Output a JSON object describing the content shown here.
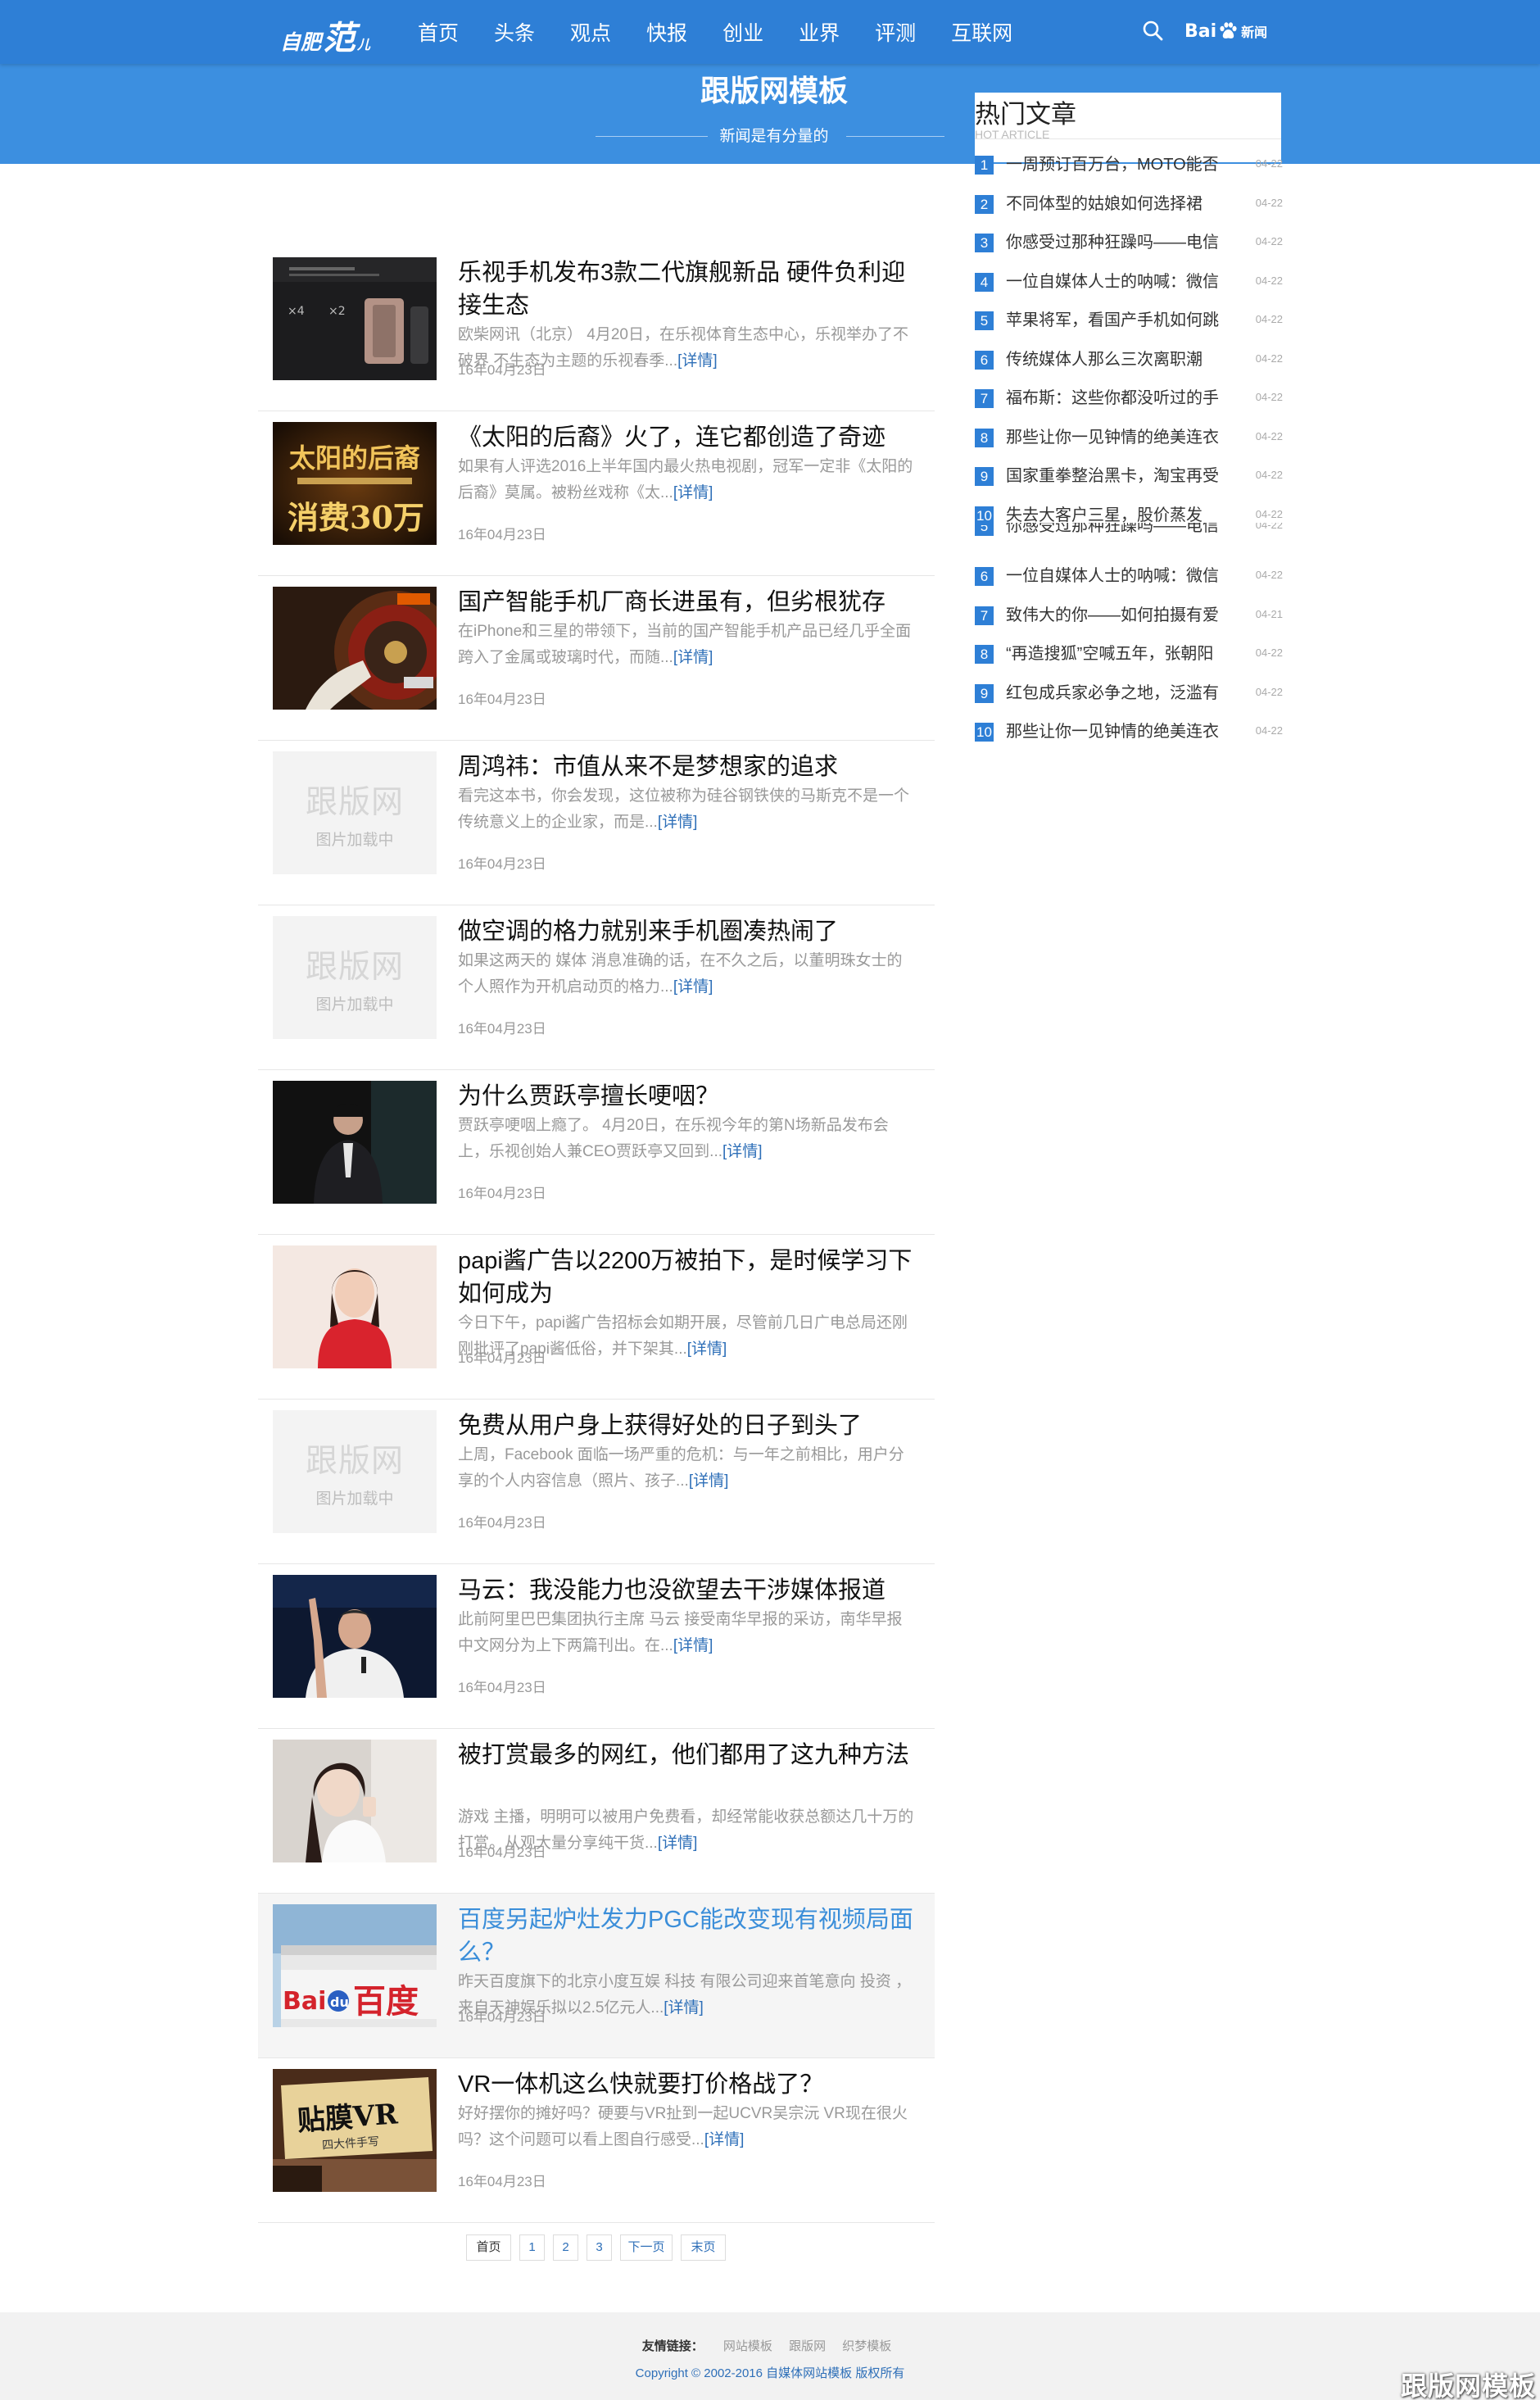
{
  "header": {
    "logo": {
      "part1": "自肥",
      "part2": "范",
      "part3": "儿"
    },
    "nav": [
      "首页",
      "头条",
      "观点",
      "快报",
      "创业",
      "业界",
      "评测",
      "互联网"
    ],
    "baidu": {
      "bai": "Bai",
      "du": "du",
      "news": "新闻"
    }
  },
  "banner": {
    "title": "跟版网模板",
    "slogan": "新闻是有分量的"
  },
  "articles": [
    {
      "title": "乐视手机发布3款二代旗舰新品 硬件负利迎接生态",
      "desc": "欧柴网讯（北京） 4月20日，在乐视体育生态中心，乐视举办了不破界 不生态为主题的乐视春季...",
      "more": "[详情]",
      "date": "16年04月23日"
    },
    {
      "title": "《太阳的后裔》火了，连它都创造了奇迹",
      "desc": "如果有人评选2016上半年国内最火热电视剧，冠军一定非《太阳的后裔》莫属。被粉丝戏称《太...",
      "more": "[详情]",
      "date": "16年04月23日"
    },
    {
      "title": "国产智能手机厂商长进虽有，但劣根犹存",
      "desc": "在iPhone和三星的带领下，当前的国产智能手机产品已经几乎全面跨入了金属或玻璃时代，而随...",
      "more": "[详情]",
      "date": "16年04月23日"
    },
    {
      "title": "周鸿祎：市值从来不是梦想家的追求",
      "desc": "看完这本书，你会发现，这位被称为硅谷钢铁侠的马斯克不是一个传统意义上的企业家，而是...",
      "more": "[详情]",
      "date": "16年04月23日"
    },
    {
      "title": "做空调的格力就别来手机圈凑热闹了",
      "desc": "如果这两天的 媒体 消息准确的话，在不久之后，以董明珠女士的个人照作为开机启动页的格力...",
      "more": "[详情]",
      "date": "16年04月23日"
    },
    {
      "title": "为什么贾跃亭擅长哽咽？",
      "desc": "贾跃亭哽咽上瘾了。 4月20日，在乐视今年的第N场新品发布会上，乐视创始人兼CEO贾跃亭又回到...",
      "more": "[详情]",
      "date": "16年04月23日"
    },
    {
      "title": "papi酱广告以2200万被拍下，是时候学习下如何成为",
      "desc": "今日下午，papi酱广告招标会如期开展，尽管前几日广电总局还刚刚批评了papi酱低俗，并下架其...",
      "more": "[详情]",
      "date": "16年04月23日"
    },
    {
      "title": "免费从用户身上获得好处的日子到头了",
      "desc": "上周，Facebook 面临一场严重的危机：与一年之前相比，用户分享的个人内容信息（照片、孩子...",
      "more": "[详情]",
      "date": "16年04月23日"
    },
    {
      "title": "马云：我没能力也没欲望去干涉媒体报道",
      "desc": "此前阿里巴巴集团执行主席 马云 接受南华早报的采访，南华早报中文网分为上下两篇刊出。在...",
      "more": "[详情]",
      "date": "16年04月23日"
    },
    {
      "title": "被打赏最多的网红，他们都用了这九种方法",
      "desc": "游戏 主播，明明可以被用户免费看，却经常能收获总额达几十万的打赏。从观大量分享纯干货...",
      "more": "[详情]",
      "date": "16年04月23日"
    },
    {
      "title": "百度另起炉灶发力PGC能改变现有视频局面么？",
      "desc": "昨天百度旗下的北京小度互娱 科技 有限公司迎来首笔意向 投资 ，来自天神娱乐拟以2.5亿元人...",
      "more": "[详情]",
      "date": "16年04月23日"
    },
    {
      "title": "VR一体机这么快就要打价格战了？",
      "desc": "好好摆你的摊好吗？硬要与VR扯到一起UCVR吴宗沅 VR现在很火吗？这个问题可以看上图自行感受...",
      "more": "[详情]",
      "date": "16年04月23日"
    }
  ],
  "placeholder": {
    "brand": "跟版网",
    "text": "图片加载中"
  },
  "pagination": [
    "首页",
    "1",
    "2",
    "3",
    "下一页",
    "末页"
  ],
  "sidebar": {
    "title": "热门文章",
    "subtitle": "HOT ARTICLE",
    "items_top": [
      {
        "num": "1",
        "text": "一周预订百万台，MOTO能否",
        "date": "04-22"
      },
      {
        "num": "2",
        "text": "不同体型的姑娘如何选择裙",
        "date": "04-22"
      },
      {
        "num": "3",
        "text": "你感受过那种狂躁吗——电信",
        "date": "04-22"
      },
      {
        "num": "4",
        "text": "一位自媒体人士的呐喊：微信",
        "date": "04-22"
      },
      {
        "num": "5",
        "text": "苹果将军，看国产手机如何跳",
        "date": "04-22"
      },
      {
        "num": "6",
        "text": "传统媒体人那么三次离职潮",
        "date": "04-22"
      },
      {
        "num": "7",
        "text": "福布斯：这些你都没听过的手",
        "date": "04-22"
      },
      {
        "num": "8",
        "text": "那些让你一见钟情的绝美连衣",
        "date": "04-22"
      },
      {
        "num": "9",
        "text": "国家重拳整治黑卡，淘宝再受",
        "date": "04-22"
      },
      {
        "num": "10",
        "text": "失去大客户三星，股价蒸发",
        "date": "04-22"
      }
    ],
    "items_bottom": [
      {
        "num": "5",
        "text": "你感受过那种狂躁吗——电信",
        "date": "04-22"
      },
      {
        "num": "6",
        "text": "一位自媒体人士的呐喊：微信",
        "date": "04-22"
      },
      {
        "num": "7",
        "text": "致伟大的你——如何拍摄有爱",
        "date": "04-21"
      },
      {
        "num": "8",
        "text": "“再造搜狐”空喊五年，张朝阳",
        "date": "04-22"
      },
      {
        "num": "9",
        "text": "红包成兵家必争之地，泛滥有",
        "date": "04-22"
      },
      {
        "num": "10",
        "text": "那些让你一见钟情的绝美连衣",
        "date": "04-22"
      }
    ]
  },
  "footer": {
    "links_label": "友情链接：",
    "links": [
      "网站模板",
      "跟版网",
      "织梦模板"
    ],
    "copyright": "Copyright © 2002-2016 自媒体网站模板 版权所有"
  },
  "watermark": "跟版网模板",
  "colors": {
    "primary": "#2e7fd6",
    "banner": "#3c8fe0",
    "link": "#2e6fb8",
    "active_title": "#3b8ed9"
  }
}
